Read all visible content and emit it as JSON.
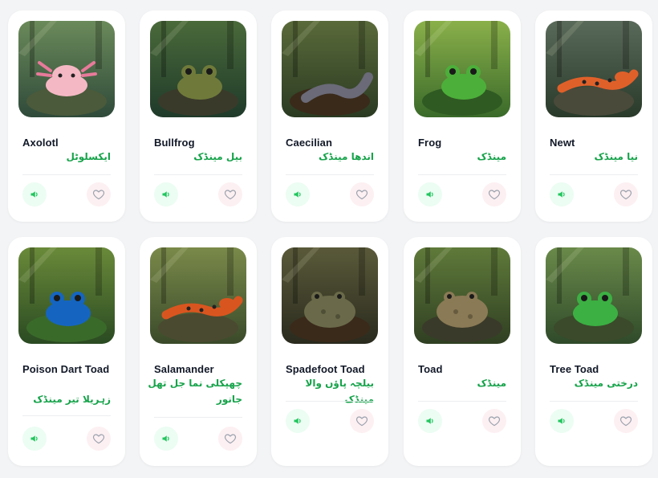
{
  "cards": [
    {
      "name": "Axolotl",
      "urdu": "ایکسلوٹل",
      "image": "axolotl-photo"
    },
    {
      "name": "Bullfrog",
      "urdu": "بیل مینڈک",
      "image": "bullfrog-photo"
    },
    {
      "name": "Caecilian",
      "urdu": "اندھا مینڈک",
      "image": "caecilian-photo"
    },
    {
      "name": "Frog",
      "urdu": "مینڈک",
      "image": "frog-photo"
    },
    {
      "name": "Newt",
      "urdu": "نیا مینڈک",
      "image": "newt-photo"
    },
    {
      "name": "Poison Dart Toad",
      "urdu": "زہریلا تیر مینڈک",
      "image": "poison-dart-toad-photo"
    },
    {
      "name": "Salamander",
      "urdu": "چھپکلی نما جل تھل جانور",
      "image": "salamander-photo"
    },
    {
      "name": "Spadefoot Toad",
      "urdu": "بیلچہ پاؤں والا مینڈک",
      "image": "spadefoot-toad-photo"
    },
    {
      "name": "Toad",
      "urdu": "مینڈک",
      "image": "toad-photo"
    },
    {
      "name": "Tree Toad",
      "urdu": "درختی مینڈک",
      "image": "tree-toad-photo"
    }
  ],
  "icons": {
    "sound": "speaker-icon",
    "favorite": "heart-icon"
  },
  "colors": {
    "accent_green": "#16a34a",
    "heart": "#9ca3af",
    "sound_bg": "#ecfdf3",
    "fav_bg": "#fdf0f2"
  }
}
